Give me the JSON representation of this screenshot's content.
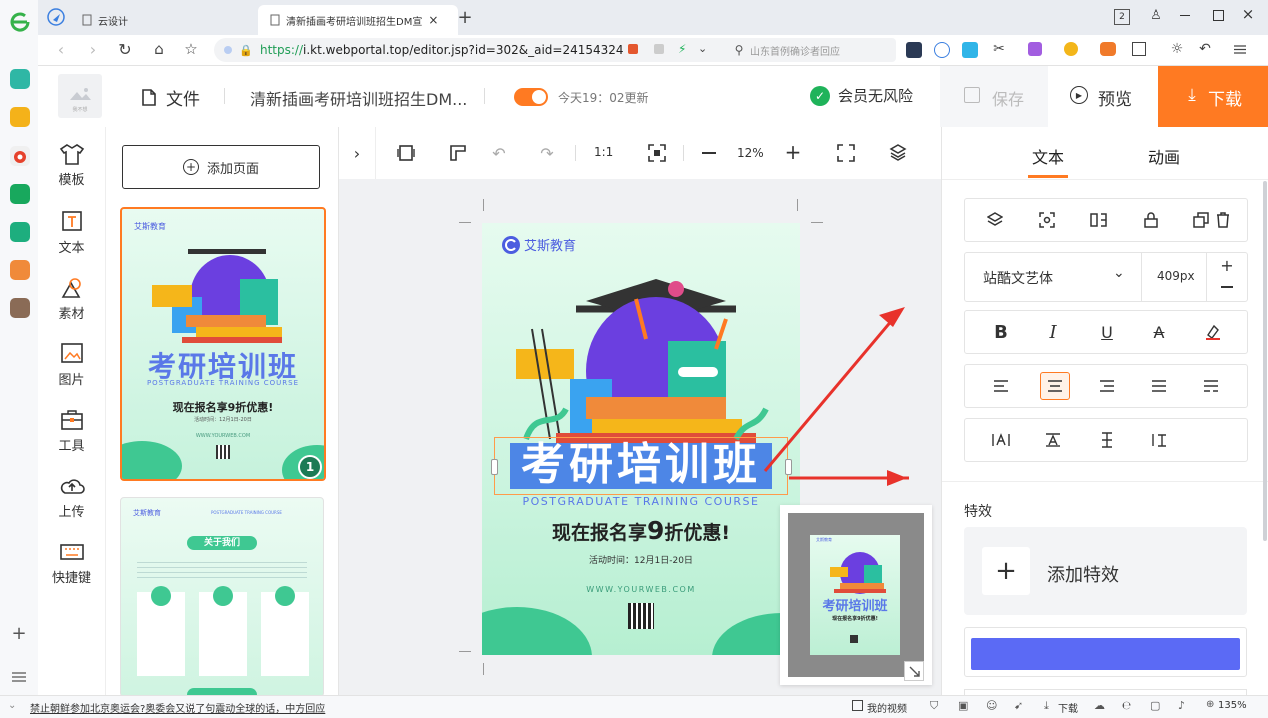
{
  "browser": {
    "tabs": [
      {
        "label": "云设计"
      },
      {
        "label": "清新插画考研培训班招生DM宣"
      }
    ],
    "url_https": "https://",
    "url_rest": "i.kt.webportal.top/editor.jsp?id=302&_aid=24154324",
    "search_placeholder": "山东首例确诊者回应",
    "window_badge": "2"
  },
  "header": {
    "file_label": "文件",
    "doc_title": "清新插画考研培训班招生DM...",
    "update_status": "今天19：02更新",
    "member_label": "会员无风险",
    "save_label": "保存",
    "preview_label": "预览",
    "download_label": "下载",
    "logo_text": "我不想"
  },
  "rail": {
    "items": [
      {
        "label": "模板"
      },
      {
        "label": "文本"
      },
      {
        "label": "素材"
      },
      {
        "label": "图片"
      },
      {
        "label": "工具"
      },
      {
        "label": "上传"
      },
      {
        "label": "快捷键"
      }
    ]
  },
  "pages": {
    "add_label": "添加页面",
    "page1_number": "1",
    "p2_brand": "艾斯教育",
    "p2_course": "POSTGRADUATE TRAINING COURSE",
    "p2_about": "关于我们"
  },
  "canvas_toolbar": {
    "ratio": "1:1",
    "zoom": "12%"
  },
  "poster": {
    "brand": "艾斯教育",
    "title": "考研培训班",
    "subtitle_en": "POSTGRADUATE TRAINING COURSE",
    "offer_a": "现在报名享",
    "offer_num": "9",
    "offer_b": "折优惠!",
    "date": "活动时间：12月1日-20日",
    "website": "WWW.YOURWEB.COM",
    "thumb_offer": "现在报名享9折优惠!",
    "thumb_date": "活动时间：12月1日-20日"
  },
  "right_panel": {
    "tab_text": "文本",
    "tab_anim": "动画",
    "font_name": "站酷文艺体",
    "font_size": "409px",
    "effects_label": "特效",
    "add_effect_label": "添加特效",
    "accent_color": "#5b6af5",
    "brand_orange": "#ff7a22"
  },
  "status": {
    "news": "禁止朝鲜参加北京奥运会?奥委会又说了句震动全球的话，中方回应",
    "my_video": "我的视频",
    "download": "下载",
    "zoom": "135%"
  }
}
